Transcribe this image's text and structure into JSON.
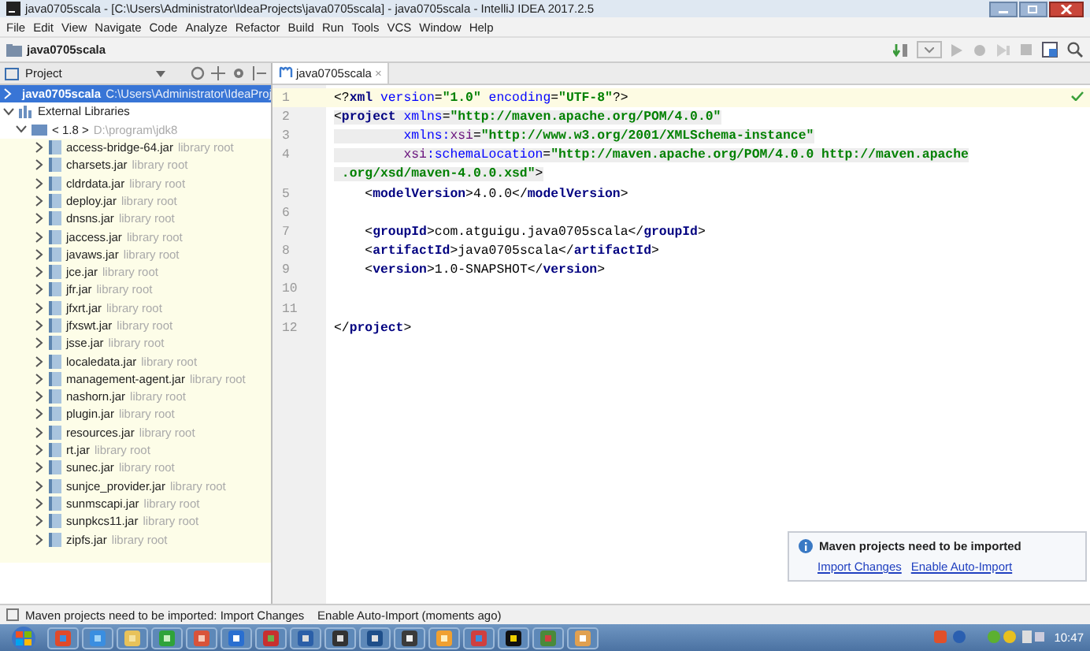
{
  "window": {
    "title": "java0705scala - [C:\\Users\\Administrator\\IdeaProjects\\java0705scala] - java0705scala - IntelliJ IDEA 2017.2.5"
  },
  "menu": [
    "File",
    "Edit",
    "View",
    "Navigate",
    "Code",
    "Analyze",
    "Refactor",
    "Build",
    "Run",
    "Tools",
    "VCS",
    "Window",
    "Help"
  ],
  "breadcrumb": "java0705scala",
  "project_panel": {
    "title": "Project",
    "root": {
      "name": "java0705scala",
      "path": "C:\\Users\\Administrator\\IdeaProj",
      "selected": true
    },
    "libraries": {
      "name": "External Libraries",
      "expanded": true
    },
    "jdk": {
      "name": "< 1.8 >",
      "path": "D:\\program\\jdk8",
      "expanded": true
    },
    "jars": [
      {
        "name": "access-bridge-64.jar",
        "note": "library root"
      },
      {
        "name": "charsets.jar",
        "note": "library root"
      },
      {
        "name": "cldrdata.jar",
        "note": "library root"
      },
      {
        "name": "deploy.jar",
        "note": "library root"
      },
      {
        "name": "dnsns.jar",
        "note": "library root"
      },
      {
        "name": "jaccess.jar",
        "note": "library root"
      },
      {
        "name": "javaws.jar",
        "note": "library root"
      },
      {
        "name": "jce.jar",
        "note": "library root"
      },
      {
        "name": "jfr.jar",
        "note": "library root"
      },
      {
        "name": "jfxrt.jar",
        "note": "library root"
      },
      {
        "name": "jfxswt.jar",
        "note": "library root"
      },
      {
        "name": "jsse.jar",
        "note": "library root"
      },
      {
        "name": "localedata.jar",
        "note": "library root"
      },
      {
        "name": "management-agent.jar",
        "note": "library root"
      },
      {
        "name": "nashorn.jar",
        "note": "library root"
      },
      {
        "name": "plugin.jar",
        "note": "library root"
      },
      {
        "name": "resources.jar",
        "note": "library root"
      },
      {
        "name": "rt.jar",
        "note": "library root"
      },
      {
        "name": "sunec.jar",
        "note": "library root"
      },
      {
        "name": "sunjce_provider.jar",
        "note": "library root"
      },
      {
        "name": "sunmscapi.jar",
        "note": "library root"
      },
      {
        "name": "sunpkcs11.jar",
        "note": "library root"
      },
      {
        "name": "zipfs.jar",
        "note": "library root"
      }
    ]
  },
  "editor_tab": {
    "label": "java0705scala",
    "close": "×"
  },
  "code": [
    {
      "number": "1",
      "current_line": true,
      "rows": [
        {
          "segments": [
            {
              "kind": "punct",
              "t": "<?"
            },
            {
              "kind": "tag",
              "t": "xml "
            },
            {
              "kind": "attr",
              "t": "version"
            },
            {
              "kind": "punct",
              "t": "="
            },
            {
              "kind": "value",
              "t": "\"1.0\" "
            },
            {
              "kind": "attr",
              "t": "encoding"
            },
            {
              "kind": "punct",
              "t": "="
            },
            {
              "kind": "value",
              "t": "\"UTF-8\""
            },
            {
              "kind": "punct",
              "t": "?>"
            }
          ]
        }
      ]
    },
    {
      "number": "2",
      "in_scope": true,
      "rows": [
        {
          "segments": [
            {
              "kind": "punct",
              "t": "<"
            },
            {
              "kind": "tag",
              "t": "project "
            },
            {
              "kind": "attr",
              "t": "xmlns"
            },
            {
              "kind": "punct",
              "t": "="
            },
            {
              "kind": "value",
              "t": "\"http://maven.apache.org/POM/4.0.0\""
            }
          ]
        }
      ]
    },
    {
      "number": "3",
      "in_scope": true,
      "rows": [
        {
          "segments": [
            {
              "kind": "attr",
              "t": "         xmlns:"
            },
            {
              "kind": "ns",
              "t": "xsi"
            },
            {
              "kind": "punct",
              "t": "="
            },
            {
              "kind": "value",
              "t": "\"http://www.w3.org/2001/XMLSchema-instance\""
            }
          ]
        }
      ]
    },
    {
      "number": "4",
      "in_scope": true,
      "rows": [
        {
          "segments": [
            {
              "kind": "ns",
              "t": "         xsi"
            },
            {
              "kind": "attr",
              "t": ":schemaLocation"
            },
            {
              "kind": "punct",
              "t": "="
            },
            {
              "kind": "value",
              "t": "\"http://maven.apache.org/POM/4.0.0 http://maven.apache"
            }
          ]
        },
        {
          "segments": [
            {
              "kind": "value",
              "t": " .org/xsd/maven-4.0.0.xsd\""
            },
            {
              "kind": "punct",
              "t": ">"
            }
          ]
        }
      ]
    },
    {
      "number": "5",
      "rows": [
        {
          "segments": [
            {
              "kind": "punct",
              "t": "    <"
            },
            {
              "kind": "tag",
              "t": "modelVersion"
            },
            {
              "kind": "punct",
              "t": ">"
            },
            {
              "kind": "text",
              "t": "4.0.0"
            },
            {
              "kind": "punct",
              "t": "</"
            },
            {
              "kind": "tag",
              "t": "modelVersion"
            },
            {
              "kind": "punct",
              "t": ">"
            }
          ]
        }
      ]
    },
    {
      "number": "6",
      "rows": [
        {
          "segments": []
        }
      ]
    },
    {
      "number": "7",
      "rows": [
        {
          "segments": [
            {
              "kind": "punct",
              "t": "    <"
            },
            {
              "kind": "tag",
              "t": "groupId"
            },
            {
              "kind": "punct",
              "t": ">"
            },
            {
              "kind": "text",
              "t": "com.atguigu.java0705scala"
            },
            {
              "kind": "punct",
              "t": "</"
            },
            {
              "kind": "tag",
              "t": "groupId"
            },
            {
              "kind": "punct",
              "t": ">"
            }
          ]
        }
      ]
    },
    {
      "number": "8",
      "rows": [
        {
          "segments": [
            {
              "kind": "punct",
              "t": "    <"
            },
            {
              "kind": "tag",
              "t": "artifactId"
            },
            {
              "kind": "punct",
              "t": ">"
            },
            {
              "kind": "text",
              "t": "java0705scala"
            },
            {
              "kind": "punct",
              "t": "</"
            },
            {
              "kind": "tag",
              "t": "artifactId"
            },
            {
              "kind": "punct",
              "t": ">"
            }
          ]
        }
      ]
    },
    {
      "number": "9",
      "rows": [
        {
          "segments": [
            {
              "kind": "punct",
              "t": "    <"
            },
            {
              "kind": "tag",
              "t": "version"
            },
            {
              "kind": "punct",
              "t": ">"
            },
            {
              "kind": "text",
              "t": "1.0-SNAPSHOT"
            },
            {
              "kind": "punct",
              "t": "</"
            },
            {
              "kind": "tag",
              "t": "version"
            },
            {
              "kind": "punct",
              "t": ">"
            }
          ]
        }
      ]
    },
    {
      "number": "10",
      "rows": [
        {
          "segments": []
        }
      ]
    },
    {
      "number": "11",
      "rows": [
        {
          "segments": []
        }
      ]
    },
    {
      "number": "12",
      "rows": [
        {
          "segments": [
            {
              "kind": "punct",
              "t": "</"
            },
            {
              "kind": "tag",
              "t": "project"
            },
            {
              "kind": "punct",
              "t": ">"
            }
          ]
        }
      ]
    }
  ],
  "notification": {
    "title": "Maven projects need to be imported",
    "links": [
      "Import Changes",
      "Enable Auto-Import"
    ]
  },
  "status_bar": {
    "message": "Maven projects need to be imported: Import Changes    Enable Auto-Import (moments ago)"
  },
  "taskbar": {
    "clock": "10:47"
  }
}
